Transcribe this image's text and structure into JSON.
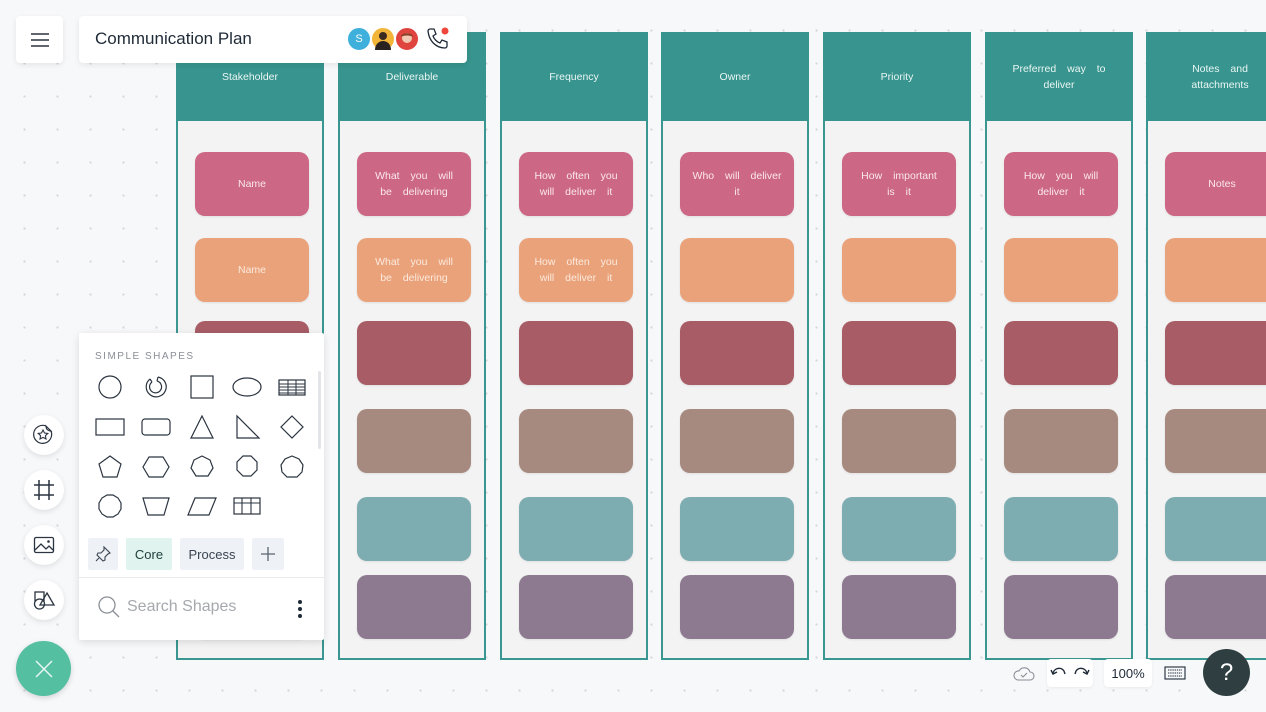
{
  "header": {
    "title": "Communication Plan",
    "collaborators": [
      {
        "initial": "S",
        "color": "#3fb0dc"
      },
      {
        "initial": "",
        "color": "#f2b53a"
      },
      {
        "initial": "",
        "color": "#e0443f"
      }
    ],
    "call_indicator_color": "#f0453c"
  },
  "columns": [
    {
      "header": "Stakeholder",
      "cards": [
        "Name",
        "Name",
        "",
        "",
        "",
        ""
      ]
    },
    {
      "header": "Deliverable",
      "cards": [
        "What you will be delivering",
        "What you will be delivering",
        "",
        "",
        "",
        ""
      ]
    },
    {
      "header": "Frequency",
      "cards": [
        "How often you will deliver it",
        "How often you will deliver it",
        "",
        "",
        "",
        ""
      ]
    },
    {
      "header": "Owner",
      "cards": [
        "Who will deliver it",
        "",
        "",
        "",
        "",
        ""
      ]
    },
    {
      "header": "Priority",
      "cards": [
        "How important is it",
        "",
        "",
        "",
        "",
        ""
      ]
    },
    {
      "header": "Preferred way to deliver",
      "cards": [
        "How you will deliver it",
        "",
        "",
        "",
        "",
        ""
      ]
    },
    {
      "header": "Notes and attachments",
      "cards": [
        "Notes",
        "",
        "",
        "",
        "",
        ""
      ]
    }
  ],
  "card_colors": [
    "#cc6785",
    "#eaa27a",
    "#a85d66",
    "#a68a80",
    "#7dadb1",
    "#8d7a90"
  ],
  "theme": {
    "header_color": "#38948e",
    "accent": "#54bfa1"
  },
  "shapes_panel": {
    "title": "SIMPLE SHAPES",
    "shapes": [
      "circle",
      "ring",
      "square",
      "ellipse",
      "table",
      "rectangle",
      "rounded-rectangle",
      "triangle",
      "right-triangle",
      "diamond",
      "pentagon",
      "hexagon",
      "heptagon",
      "octagon",
      "nonagon",
      "decagon",
      "trapezoid",
      "parallelogram",
      "grid"
    ],
    "tabs": [
      {
        "label": "Core",
        "active": true
      },
      {
        "label": "Process",
        "active": false
      }
    ],
    "search_placeholder": "Search Shapes"
  },
  "footer": {
    "zoom_level": "100%",
    "help_label": "?"
  }
}
